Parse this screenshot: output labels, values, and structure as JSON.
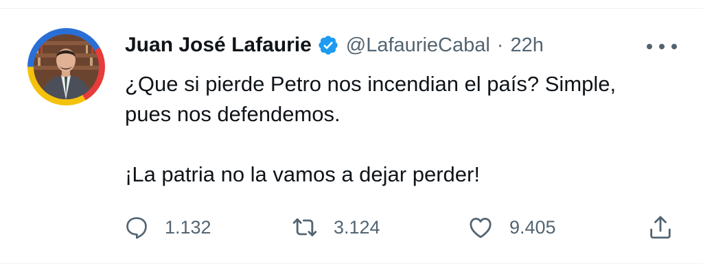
{
  "tweet": {
    "author": {
      "display_name": "Juan José Lafaurie",
      "handle": "@LafaurieCabal",
      "verified": true
    },
    "separator": "·",
    "time": "22h",
    "text_lines": {
      "line1": "¿Que si pierde Petro nos incendian el país? Simple,",
      "line2": "pues nos defendemos.",
      "line3": "¡La patria no la vamos a dejar perder!"
    },
    "stats": {
      "replies": "1.132",
      "retweets": "3.124",
      "likes": "9.405"
    }
  },
  "icons": {
    "verified": "verified-badge-icon",
    "more": "more-options-icon",
    "reply": "reply-icon",
    "retweet": "retweet-icon",
    "like": "heart-icon",
    "share": "share-icon"
  },
  "colors": {
    "text_primary": "#0f1419",
    "text_secondary": "#536471",
    "verified_blue": "#1d9bf0",
    "divider": "#eff3f4"
  }
}
